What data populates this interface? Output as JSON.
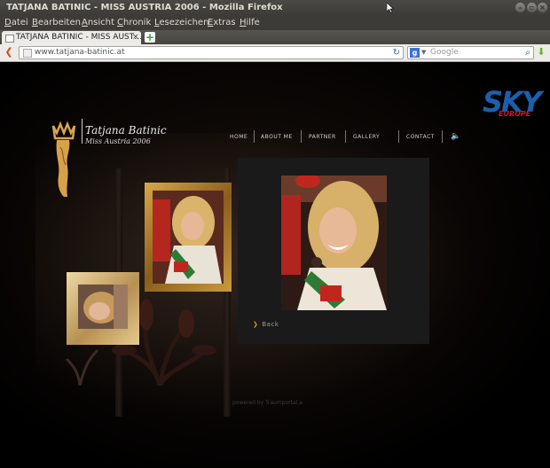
{
  "window": {
    "title": "TATJANA BATINIC - MISS AUSTRIA 2006 - Mozilla Firefox"
  },
  "menu": [
    "Datei",
    "Bearbeiten",
    "Ansicht",
    "Chronik",
    "Lesezeichen",
    "Extras",
    "Hilfe"
  ],
  "tab": {
    "label": "TATJANA BATINIC - MISS AUST…",
    "close": "×",
    "new_tab": "+"
  },
  "navbar": {
    "url": "www.tatjana-batinic.at",
    "search_engine": "Google",
    "search_placeholder": "Google"
  },
  "site": {
    "sponsor_logo": "SKY",
    "sponsor_sub": "EUROPE",
    "name": "Tatjana Batinic",
    "subtitle": "Miss Austria 2006",
    "nav": [
      "HOME",
      "ABOUT ME",
      "PARTNER",
      "GALLERY",
      "CONTACT"
    ],
    "back_label": "Back",
    "powered_by": "powered by Traumportal.a",
    "accent_color": "#d0a21a",
    "sponsor_color": "#1b5fad"
  },
  "icons": {
    "back": "back-arrow-icon",
    "reload": "reload-icon",
    "search": "magnifier-icon",
    "download": "download-icon",
    "speaker": "speaker-icon",
    "crown": "crown-logo-icon"
  }
}
